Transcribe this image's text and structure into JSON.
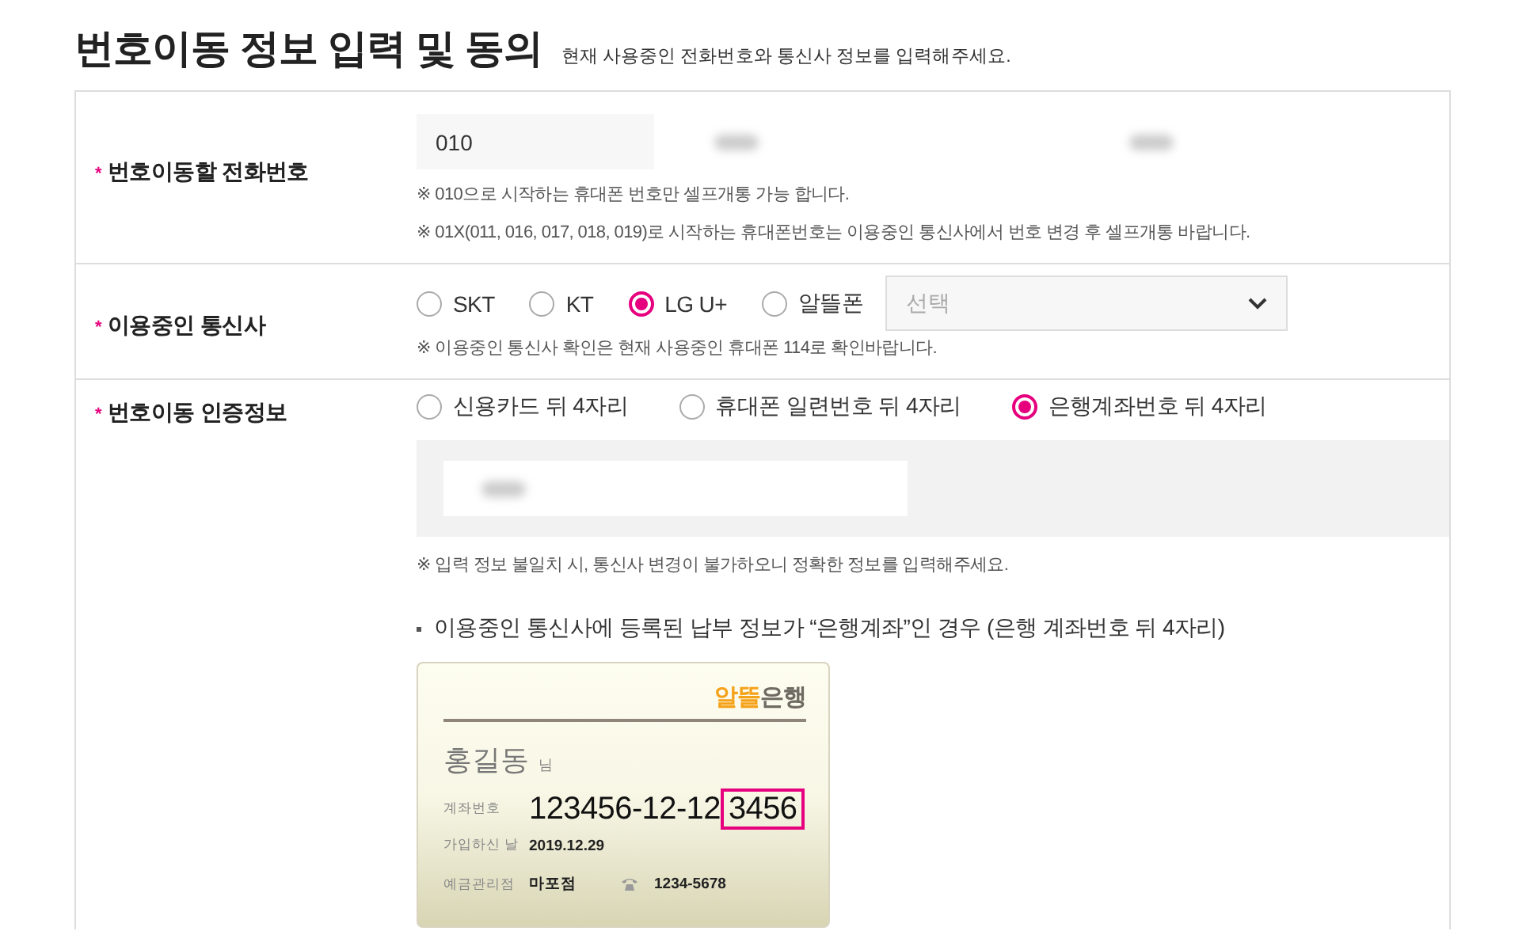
{
  "heading": {
    "title": "번호이동 정보 입력 및 동의",
    "subtitle": "현재 사용중인 전화번호와 통신사 정보를 입력해주세요."
  },
  "rows": [
    {
      "kind": "phone",
      "mark": "*",
      "label": "번호이동할 전화번호",
      "fields": [
        {
          "value": "010",
          "blurred": false
        },
        {
          "blurred": true
        },
        {
          "blurred": true
        }
      ],
      "notes": [
        "※ 010으로 시작하는 휴대폰 번호만 셀프개통 가능 합니다.",
        "※ 01X(011, 016, 017, 018, 019)로 시작하는 휴대폰번호는 이용중인 통신사에서 번호 변경 후 셀프개통 바랍니다."
      ]
    },
    {
      "kind": "carrier",
      "mark": "*",
      "label": "이용중인 통신사",
      "options": [
        {
          "label": "SKT",
          "selected": false
        },
        {
          "label": "KT",
          "selected": false
        },
        {
          "label": "LG U+",
          "selected": true
        },
        {
          "label": "알뜰폰",
          "selected": false
        }
      ],
      "select": {
        "placeholder": "선택"
      },
      "notes": [
        "※ 이용중인 통신사 확인은 현재 사용중인 휴대폰 114로 확인바랍니다."
      ]
    },
    {
      "kind": "auth",
      "mark": "*",
      "label": "번호이동 인증정보",
      "options": [
        {
          "label": "신용카드 뒤 4자리",
          "selected": false
        },
        {
          "label": "휴대폰 일련번호 뒤 4자리",
          "selected": false
        },
        {
          "label": "은행계좌번호 뒤 4자리",
          "selected": true
        }
      ],
      "field": {
        "blurred": true
      },
      "notes": [
        "※ 입력 정보 불일치 시, 통신사 변경이 불가하오니 정확한 정보를 입력해주세요."
      ],
      "guide": "이용중인 통신사에 등록된 납부 정보가 “은행계좌”인 경우 (은행 계좌번호 뒤 4자리)",
      "card": {
        "bank_accent": "알뜰",
        "bank": "은행",
        "holder": "홍길동",
        "holder_suffix": "님",
        "account_label": "계좌번호",
        "account_prefix": "123456-12-12",
        "account_highlight": "3456",
        "join_label": "가입하신 날",
        "join_date": "2019.12.29",
        "branch_label": "예금관리점",
        "branch": "마포점",
        "branch_phone": "1234-5678"
      }
    }
  ]
}
